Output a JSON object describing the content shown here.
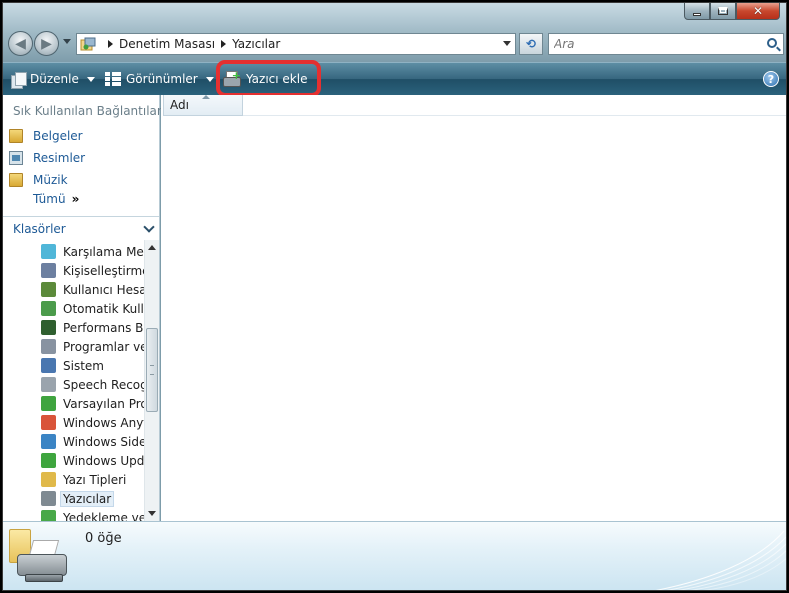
{
  "window": {
    "caption": {
      "minimize_icon": "minimize-icon",
      "maximize_icon": "maximize-icon",
      "close_icon": "close-icon",
      "close_glyph": "✕"
    }
  },
  "address_bar": {
    "breadcrumbs": [
      "Denetim Masası",
      "Yazıcılar"
    ],
    "search_placeholder": "Ara"
  },
  "toolbar": {
    "organize_label": "Düzenle",
    "views_label": "Görünümler",
    "add_printer_label": "Yazıcı ekle",
    "help_glyph": "?",
    "highlight_color": "#e53030"
  },
  "navigation_pane": {
    "favorites_title": "Sık Kullanılan Bağlantılar",
    "favorites": [
      {
        "label": "Belgeler",
        "icon": "folder-icon"
      },
      {
        "label": "Resimler",
        "icon": "pictures-icon"
      },
      {
        "label": "Müzik",
        "icon": "folder-icon"
      }
    ],
    "more_label": "Tümü",
    "more_glyph": "»",
    "folders_title": "Klasörler",
    "folders": [
      {
        "label": "Karşılama Merk",
        "icon": "welcome-center-icon",
        "color": "#4fb6d8"
      },
      {
        "label": "Kişiselleştirme",
        "icon": "personalization-icon",
        "color": "#6c7fa0"
      },
      {
        "label": "Kullanıcı Hesap",
        "icon": "user-accounts-icon",
        "color": "#5b8a3a"
      },
      {
        "label": "Otomatik Kulla",
        "icon": "autoplay-icon",
        "color": "#4b9b4b"
      },
      {
        "label": "Performans Bil",
        "icon": "performance-icon",
        "color": "#2f5f2f"
      },
      {
        "label": "Programlar ve",
        "icon": "programs-icon",
        "color": "#8893a1"
      },
      {
        "label": "Sistem",
        "icon": "system-icon",
        "color": "#4a77b0"
      },
      {
        "label": "Speech Recogn",
        "icon": "microphone-icon",
        "color": "#9aa4ad"
      },
      {
        "label": "Varsayılan Prog",
        "icon": "default-programs-icon",
        "color": "#3fa43f"
      },
      {
        "label": "Windows Anyt",
        "icon": "windows-anytime-icon",
        "color": "#d9543a"
      },
      {
        "label": "Windows SideS",
        "icon": "sidebar-icon",
        "color": "#3b84c4"
      },
      {
        "label": "Windows Upda",
        "icon": "windows-update-icon",
        "color": "#3ea53e"
      },
      {
        "label": "Yazı Tipleri",
        "icon": "fonts-icon",
        "color": "#e0b94a"
      },
      {
        "label": "Yazıcılar",
        "icon": "printers-icon",
        "color": "#7f8a92",
        "selected": true
      },
      {
        "label": "Yedekleme ve",
        "icon": "backup-icon",
        "color": "#48a848"
      }
    ]
  },
  "content": {
    "column_header": "Adı"
  },
  "details_pane": {
    "item_count": "0 öğe",
    "icon": "printer-icon"
  }
}
